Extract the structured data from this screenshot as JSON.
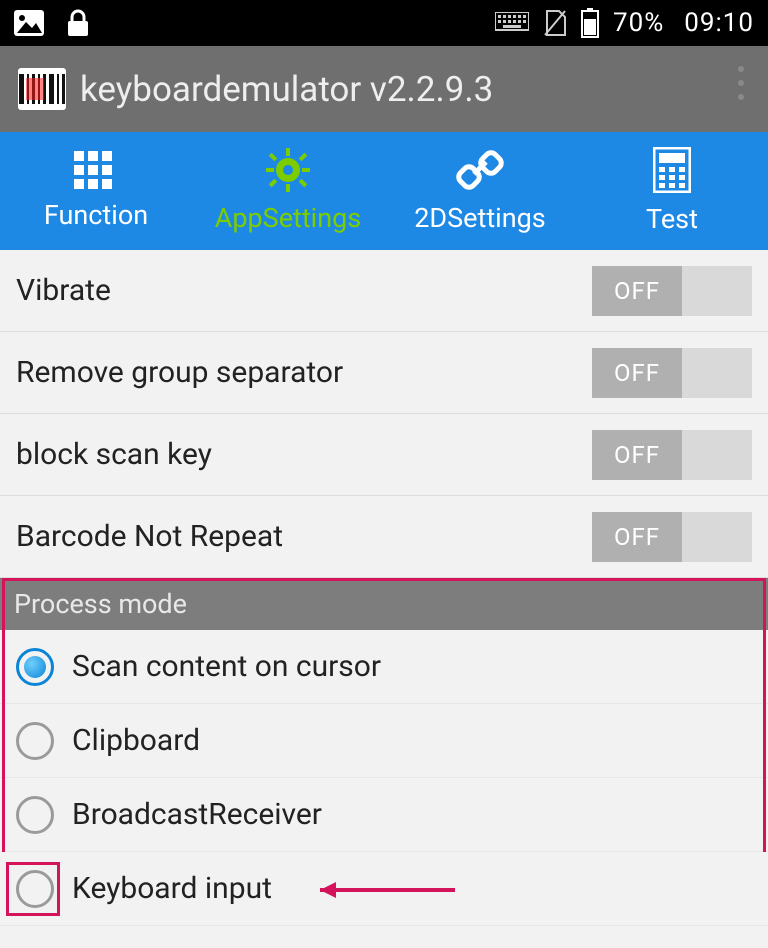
{
  "statusbar": {
    "battery": "70%",
    "time": "09:10"
  },
  "appbar": {
    "title": "keyboardemulator v2.2.9.3"
  },
  "tabs": [
    {
      "label": "Function"
    },
    {
      "label": "AppSettings"
    },
    {
      "label": "2DSettings"
    },
    {
      "label": "Test"
    }
  ],
  "settings": [
    {
      "label": "Vibrate",
      "state": "OFF"
    },
    {
      "label": "Remove group separator",
      "state": "OFF"
    },
    {
      "label": "block scan key",
      "state": "OFF"
    },
    {
      "label": "Barcode Not Repeat",
      "state": "OFF"
    }
  ],
  "process_mode": {
    "header": "Process mode",
    "options": [
      {
        "label": "Scan content on cursor"
      },
      {
        "label": "Clipboard"
      },
      {
        "label": "BroadcastReceiver"
      },
      {
        "label": "Keyboard input"
      }
    ]
  }
}
